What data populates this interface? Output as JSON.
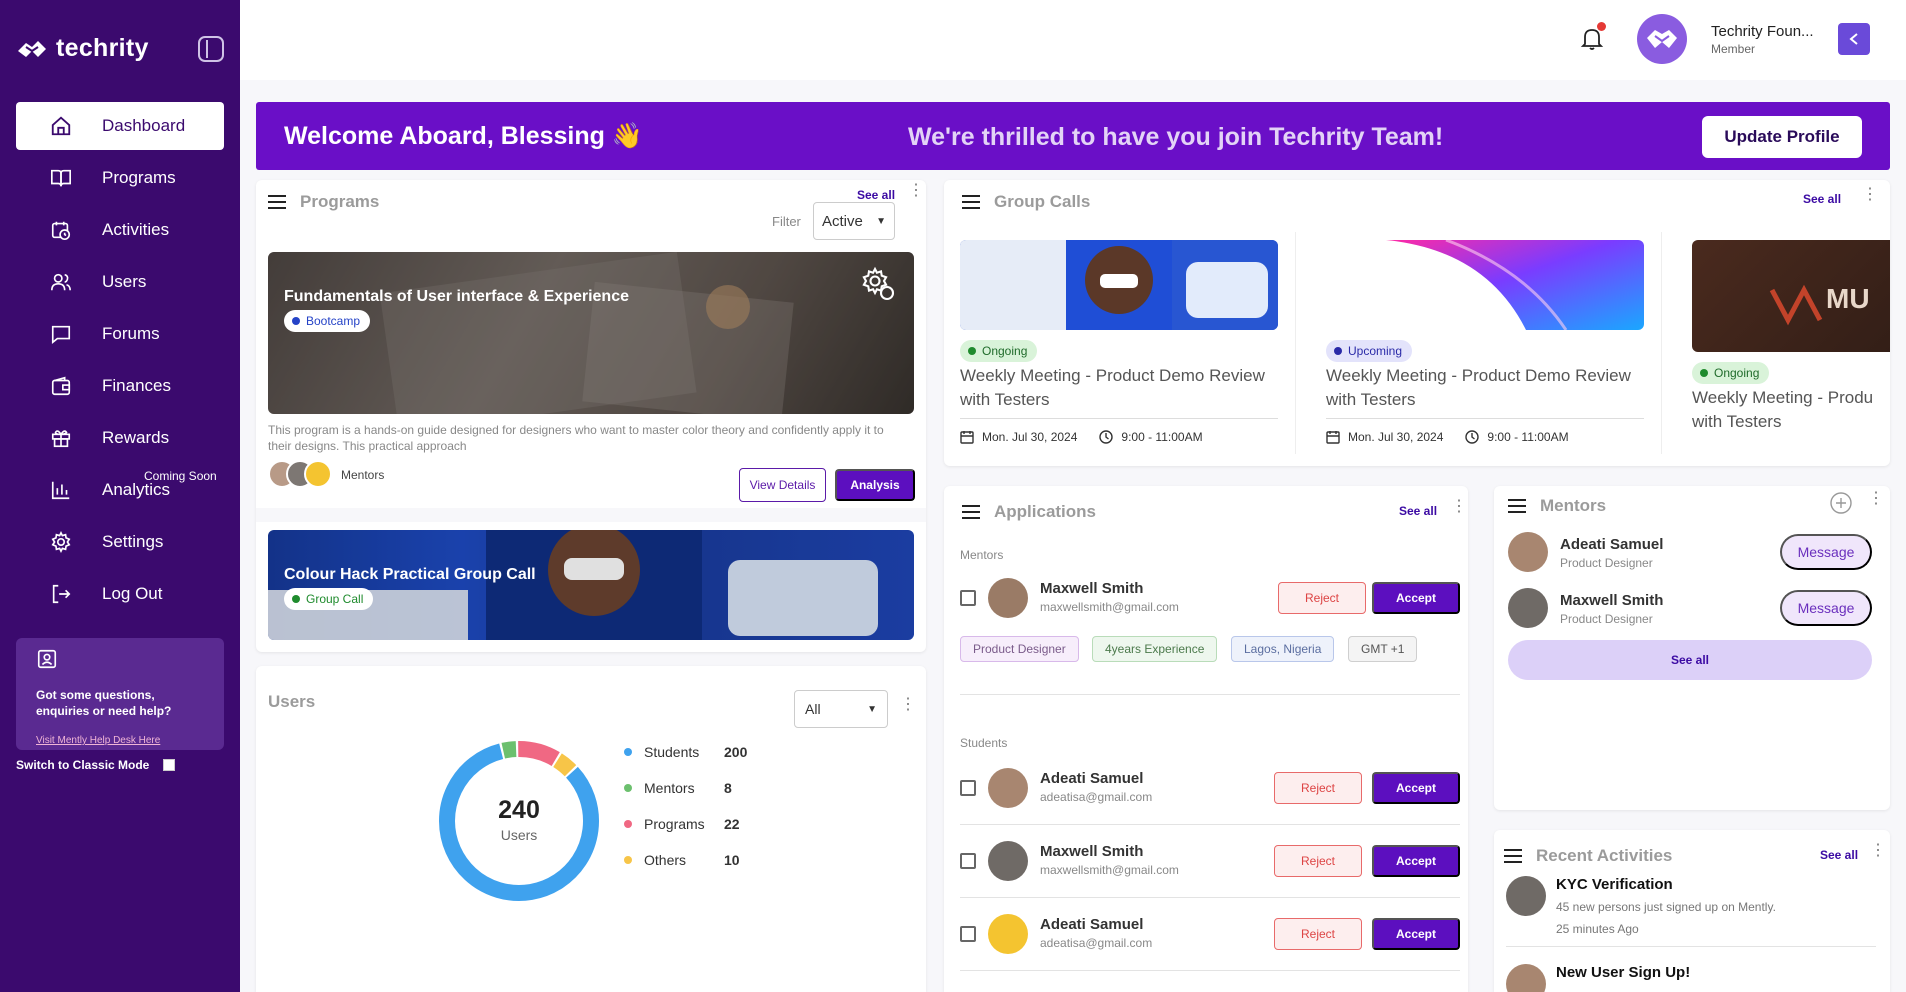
{
  "sidebar": {
    "brand": "techrity",
    "nav": [
      {
        "label": "Dashboard",
        "icon": "home-icon"
      },
      {
        "label": "Programs",
        "icon": "book-icon"
      },
      {
        "label": "Activities",
        "icon": "calendar-clock-icon"
      },
      {
        "label": "Users",
        "icon": "users-icon"
      },
      {
        "label": "Forums",
        "icon": "chat-icon"
      },
      {
        "label": "Finances",
        "icon": "wallet-icon"
      },
      {
        "label": "Rewards",
        "icon": "gift-icon"
      },
      {
        "label": "Analytics",
        "icon": "bar-chart-icon"
      },
      {
        "label": "Settings",
        "icon": "gear-icon"
      },
      {
        "label": "Log Out",
        "icon": "logout-icon"
      }
    ],
    "coming_soon": "Coming Soon",
    "help_text": "Got some questions, enquiries or need help?",
    "help_link": "Visit Mently Help Desk Here",
    "classic_mode": "Switch to Classic Mode"
  },
  "header": {
    "user_name": "Techrity Foun...",
    "user_role": "Member"
  },
  "banner": {
    "title": "Welcome Aboard, Blessing",
    "emoji": "👋",
    "message": "We're thrilled to have you join Techrity Team!",
    "button": "Update Profile"
  },
  "programs": {
    "title": "Programs",
    "see_all": "See all",
    "filter_label": "Filter",
    "filter_value": "Active",
    "items": [
      {
        "title": "Fundamentals of User interface & Experience",
        "tag": "Bootcamp",
        "description": "This program is a hands-on guide designed for designers who want to master color theory and confidently apply it to their designs. This practical approach",
        "mentors_label": "Mentors",
        "view_btn": "View Details",
        "analysis_btn": "Analysis"
      },
      {
        "title": "Colour Hack Practical Group Call",
        "tag": "Group Call"
      }
    ]
  },
  "users": {
    "title": "Users",
    "select_value": "All",
    "total": "240",
    "total_label": "Users",
    "legend": [
      {
        "name": "Students",
        "value": "200",
        "color": "#3fa2ee"
      },
      {
        "name": "Mentors",
        "value": "8",
        "color": "#6cc06e"
      },
      {
        "name": "Programs",
        "value": "22",
        "color": "#f06883"
      },
      {
        "name": "Others",
        "value": "10",
        "color": "#f7c548"
      }
    ]
  },
  "group_calls": {
    "title": "Group Calls",
    "see_all": "See all",
    "items": [
      {
        "status": "Ongoing",
        "title": "Weekly Meeting - Product Demo Review with Testers",
        "date": "Mon. Jul 30, 2024",
        "time": "9:00 - 11:00AM"
      },
      {
        "status": "Upcoming",
        "title": "Weekly Meeting - Product Demo Review with Testers",
        "date": "Mon. Jul 30, 2024",
        "time": "9:00 - 11:00AM"
      },
      {
        "status": "Ongoing",
        "title": "Weekly Meeting - Produ with Testers"
      }
    ]
  },
  "applications": {
    "title": "Applications",
    "see_all": "See all",
    "mentors_label": "Mentors",
    "students_label": "Students",
    "reject": "Reject",
    "accept": "Accept",
    "mentor": {
      "name": "Maxwell Smith",
      "email": "maxwellsmith@gmail.com"
    },
    "tags": [
      "Product Designer",
      "4years Experience",
      "Lagos, Nigeria",
      "GMT +1"
    ],
    "students": [
      {
        "name": "Adeati Samuel",
        "email": "adeatisa@gmail.com"
      },
      {
        "name": "Maxwell Smith",
        "email": "maxwellsmith@gmail.com"
      },
      {
        "name": "Adeati Samuel",
        "email": "adeatisa@gmail.com"
      }
    ]
  },
  "mentors": {
    "title": "Mentors",
    "items": [
      {
        "name": "Adeati Samuel",
        "role": "Product Designer"
      },
      {
        "name": "Maxwell Smith",
        "role": "Product Designer"
      }
    ],
    "message_btn": "Message",
    "see_all": "See all"
  },
  "recent": {
    "title": "Recent Activities",
    "see_all": "See all",
    "items": [
      {
        "title": "KYC Verification",
        "desc": "45 new persons just signed up on Mently.",
        "time": "25 minutes Ago"
      },
      {
        "title": "New User Sign Up!"
      }
    ]
  }
}
